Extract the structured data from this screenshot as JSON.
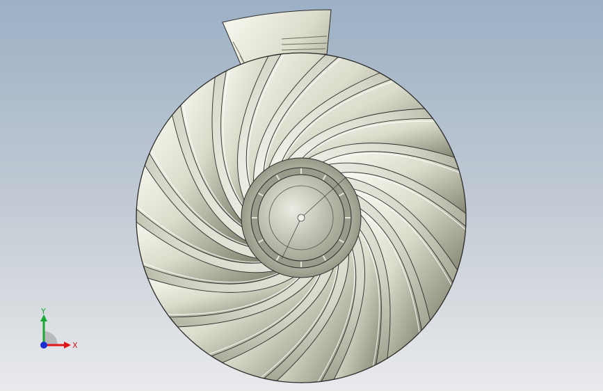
{
  "viewport": {
    "view": "front"
  },
  "model": {
    "part": "impeller",
    "blade_count": 18
  },
  "triad": {
    "x_label": "X",
    "y_label": "Y",
    "x_color": "#e0161a",
    "y_color": "#19a833",
    "z_color": "#1a2fd4"
  },
  "colors": {
    "background_top": "#9cb0c5",
    "background_bottom": "#e9eaec",
    "metal_light": "#f4f4ec",
    "metal_dark": "#8a8a7a",
    "outline": "#2a2a2a"
  }
}
